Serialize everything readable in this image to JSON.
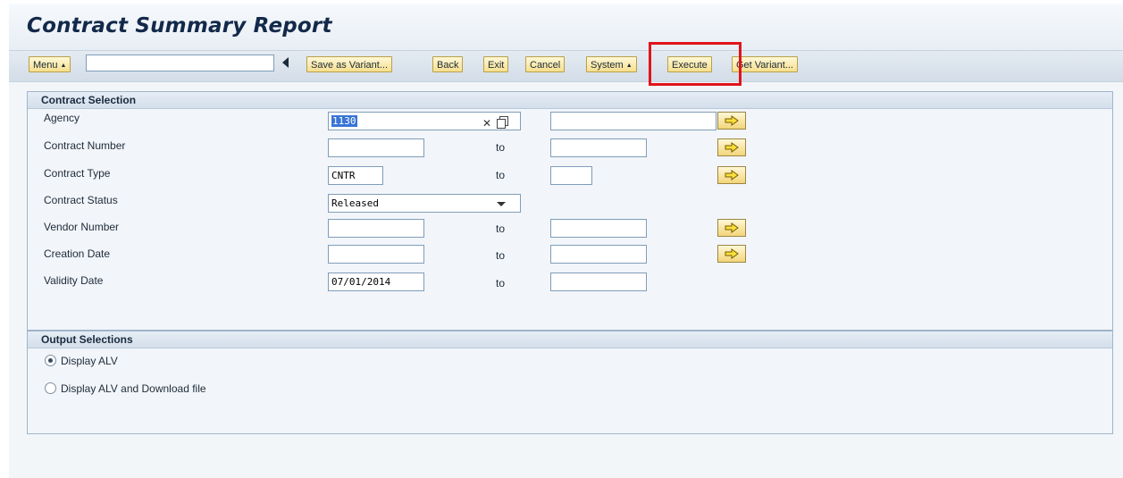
{
  "page": {
    "title": "Contract Summary Report"
  },
  "toolbar": {
    "menu_label": "Menu",
    "command_value": "",
    "buttons": {
      "save_variant": "Save as Variant...",
      "back": "Back",
      "exit": "Exit",
      "cancel": "Cancel",
      "system": "System",
      "execute": "Execute",
      "get_variant": "Get Variant..."
    }
  },
  "contract_selection": {
    "header": "Contract Selection",
    "to_label": "to",
    "rows": [
      {
        "label": "Agency",
        "from": "1130",
        "to": ""
      },
      {
        "label": "Contract Number",
        "from": "",
        "to": ""
      },
      {
        "label": "Contract Type",
        "from": "CNTR",
        "to": ""
      },
      {
        "label": "Contract Status",
        "from": "Released"
      },
      {
        "label": "Vendor Number",
        "from": "",
        "to": ""
      },
      {
        "label": "Creation Date",
        "from": "",
        "to": ""
      },
      {
        "label": "Validity Date",
        "from": "07/01/2014",
        "to": ""
      }
    ]
  },
  "output_selections": {
    "header": "Output Selections",
    "options": [
      {
        "label": "Display ALV",
        "selected": true
      },
      {
        "label": "Display ALV and Download file",
        "selected": false
      }
    ]
  },
  "icons": {
    "menu_dropdown": "triangle-up-icon",
    "collapse": "left-arrow-icon",
    "multiple_selection": "yellow-arrow-right-icon",
    "clear": "close-icon",
    "copy": "copy-icon",
    "dropdown": "chevron-down-icon"
  },
  "colors": {
    "button_fill": "#f6df8e",
    "highlight": "#e0141c",
    "title": "#13294a",
    "group_border": "#9fb4cc"
  }
}
